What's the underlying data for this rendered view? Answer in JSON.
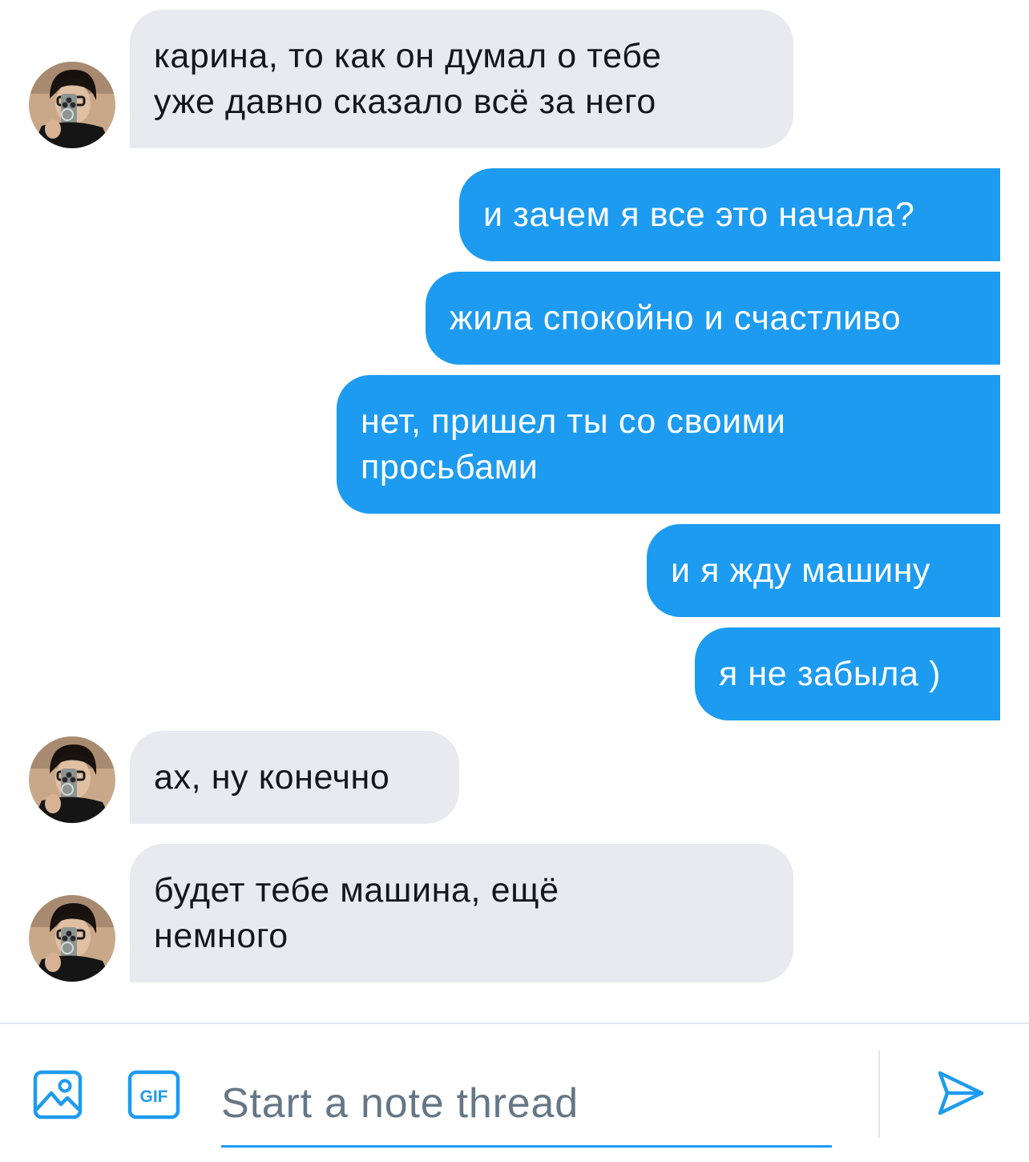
{
  "messages": [
    {
      "direction": "incoming",
      "text": "карина, то как он думал о тебе\nуже давно сказало всё за него"
    },
    {
      "direction": "outgoing",
      "text": "и зачем я все это начала?"
    },
    {
      "direction": "outgoing",
      "text": "жила спокойно и счастливо"
    },
    {
      "direction": "outgoing",
      "text": "нет, пришел ты со своими\nпросьбами"
    },
    {
      "direction": "outgoing",
      "text": "и я жду машину"
    },
    {
      "direction": "outgoing",
      "text": "я не забыла )"
    },
    {
      "direction": "incoming",
      "text": "ах, ну конечно"
    },
    {
      "direction": "incoming",
      "text": "будет тебе машина, ещё\nнемного"
    }
  ],
  "composer": {
    "placeholder": "Start a note thread",
    "gif_label": "GIF"
  },
  "colors": {
    "outgoing_bubble": "#1d9bf0",
    "incoming_bubble": "#e8eaf0",
    "accent": "#1d9bf0"
  }
}
